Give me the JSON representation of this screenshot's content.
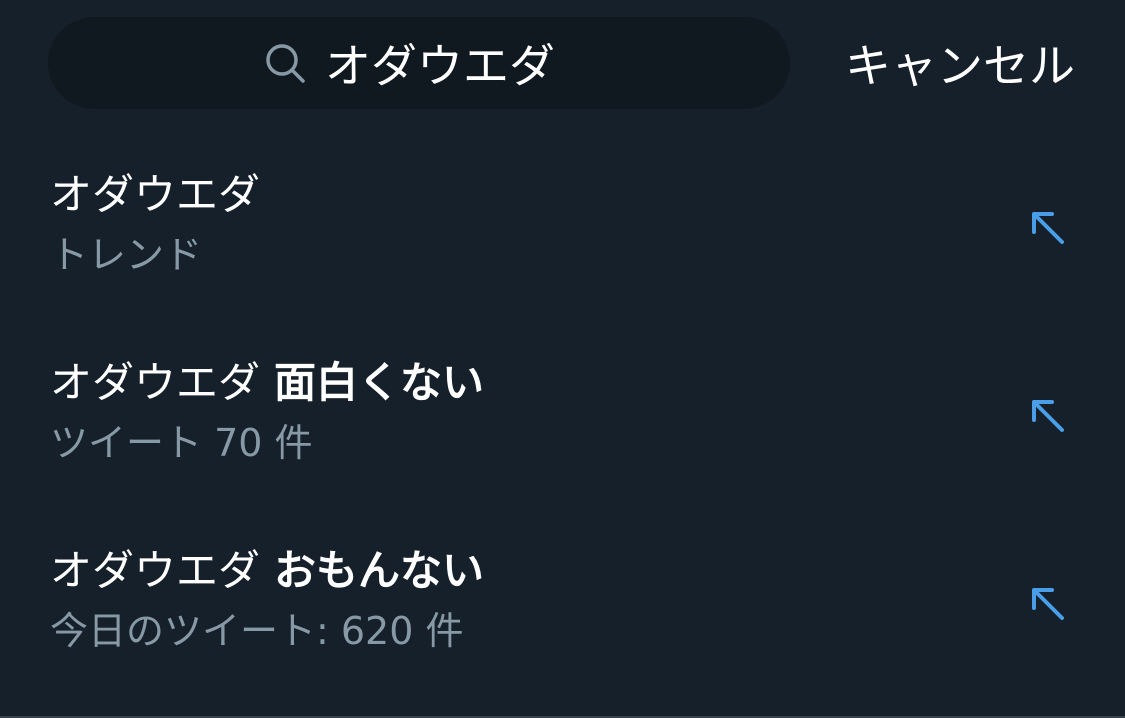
{
  "search": {
    "query": "オダウエダ",
    "icon": "search-icon",
    "cancel_label": "キャンセル"
  },
  "suggestions": [
    {
      "query": "オダウエダ",
      "extra": "",
      "subtitle": "トレンド",
      "icon": "arrow-up-left-icon"
    },
    {
      "query": "オダウエダ",
      "extra": "面白くない",
      "subtitle": "ツイート 70 件",
      "icon": "arrow-up-left-icon"
    },
    {
      "query": "オダウエダ",
      "extra": "おもんない",
      "subtitle": "今日のツイート: 620 件",
      "icon": "arrow-up-left-icon"
    }
  ],
  "colors": {
    "background": "#15202b",
    "search_field": "#101820",
    "text_primary": "#ffffff",
    "text_secondary": "#8899a6",
    "accent": "#4a9ee8"
  }
}
